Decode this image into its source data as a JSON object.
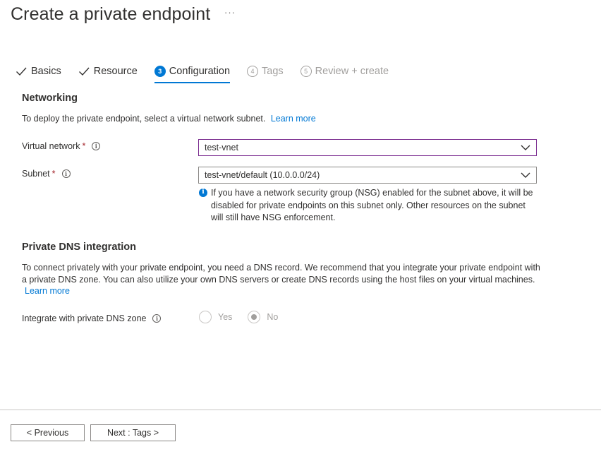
{
  "page": {
    "title": "Create a private endpoint",
    "more_glyph": "···"
  },
  "tabs": [
    {
      "label": "Basics",
      "state": "done"
    },
    {
      "label": "Resource",
      "state": "done"
    },
    {
      "label": "Configuration",
      "state": "active",
      "step": "3"
    },
    {
      "label": "Tags",
      "state": "disabled",
      "step": "4"
    },
    {
      "label": "Review + create",
      "state": "disabled",
      "step": "5"
    }
  ],
  "networking": {
    "heading": "Networking",
    "description": "To deploy the private endpoint, select a virtual network subnet.",
    "learn_more": "Learn more",
    "virtual_network": {
      "label": "Virtual network",
      "required": "*",
      "value": "test-vnet"
    },
    "subnet": {
      "label": "Subnet",
      "required": "*",
      "value": "test-vnet/default (10.0.0.0/24)"
    },
    "nsg_note": "If you have a network security group (NSG) enabled for the subnet above, it will be disabled for private endpoints on this subnet only. Other resources on the subnet will still have NSG enforcement."
  },
  "dns": {
    "heading": "Private DNS integration",
    "description": "To connect privately with your private endpoint, you need a DNS record. We recommend that you integrate your private endpoint with a private DNS zone. You can also utilize your own DNS servers or create DNS records using the host files on your virtual machines.",
    "learn_more": "Learn more",
    "integrate_label": "Integrate with private DNS zone",
    "options": [
      {
        "label": "Yes",
        "selected": false
      },
      {
        "label": "No",
        "selected": true
      }
    ]
  },
  "footer": {
    "previous": "< Previous",
    "next": "Next : Tags >"
  },
  "colors": {
    "accent": "#0078d4",
    "required": "#a4262c",
    "focus_border": "#7a2b8f",
    "disabled_text": "#a19f9d"
  },
  "icons": {
    "info": "i",
    "check": "checkmark-icon",
    "chevron": "chevron-down-icon"
  }
}
